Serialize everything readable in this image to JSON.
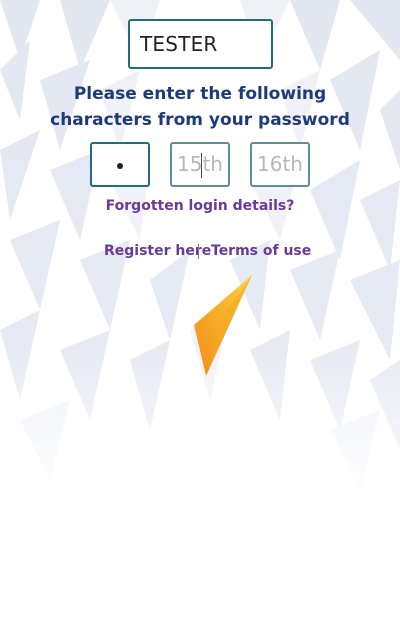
{
  "login": {
    "username_value": "TESTER",
    "prompt_line1": "Please enter the following",
    "prompt_line2": "characters from your password",
    "password_fields": [
      {
        "state": "filled"
      },
      {
        "placeholder": "15th"
      },
      {
        "placeholder": "16th"
      }
    ],
    "forgot_label": "Forgotten login details?",
    "register_label": "Register here",
    "separator": "|",
    "terms_label": "Terms of use"
  },
  "colors": {
    "primary_text": "#1d3a7a",
    "link": "#6a3a9a",
    "border": "#1f6f7a",
    "logo": "orange-yellow gradient"
  },
  "icons": [
    "triangle-pattern-background",
    "logo-icon"
  ]
}
